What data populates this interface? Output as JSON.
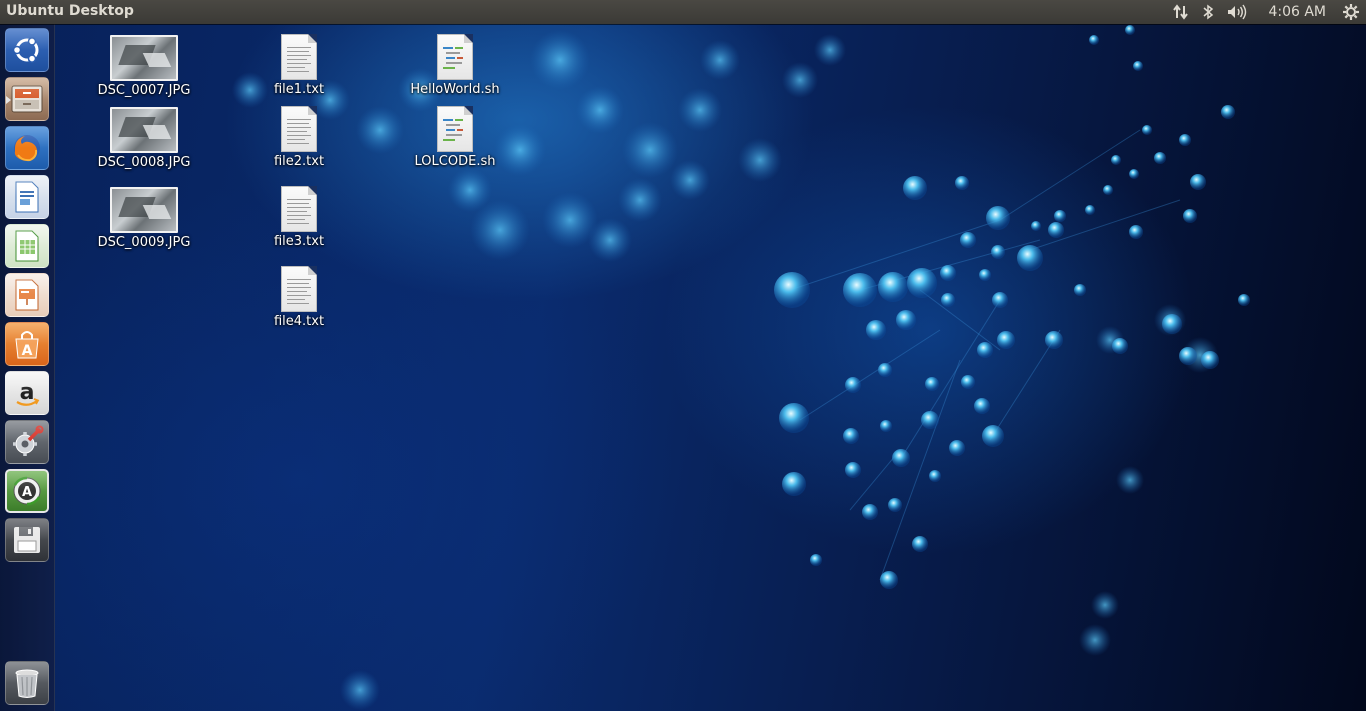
{
  "panel": {
    "title": "Ubuntu Desktop",
    "clock": "4:06 AM",
    "indicators": [
      "network-icon",
      "bluetooth-icon",
      "volume-icon",
      "session-gear-icon"
    ]
  },
  "launcher": {
    "items": [
      {
        "name": "dash-home-button",
        "icon": "ubuntu-logo-icon"
      },
      {
        "name": "files-button",
        "icon": "file-cabinet-icon"
      },
      {
        "name": "firefox-button",
        "icon": "firefox-icon"
      },
      {
        "name": "libreoffice-writer-button",
        "icon": "writer-document-icon"
      },
      {
        "name": "libreoffice-calc-button",
        "icon": "calc-spreadsheet-icon"
      },
      {
        "name": "libreoffice-impress-button",
        "icon": "impress-presentation-icon"
      },
      {
        "name": "ubuntu-software-center-button",
        "icon": "shopping-bag-icon"
      },
      {
        "name": "amazon-button",
        "icon": "amazon-icon"
      },
      {
        "name": "system-settings-button",
        "icon": "settings-wrench-icon"
      },
      {
        "name": "software-updater-button",
        "icon": "updater-icon"
      },
      {
        "name": "save-disk-button",
        "icon": "floppy-disk-icon"
      },
      {
        "name": "trash-button",
        "icon": "trash-icon"
      }
    ]
  },
  "desktop": {
    "icons": [
      {
        "label": "DSC_0007.JPG",
        "type": "image"
      },
      {
        "label": "DSC_0008.JPG",
        "type": "image"
      },
      {
        "label": "DSC_0009.JPG",
        "type": "image"
      },
      {
        "label": "file1.txt",
        "type": "text"
      },
      {
        "label": "file2.txt",
        "type": "text"
      },
      {
        "label": "file3.txt",
        "type": "text"
      },
      {
        "label": "file4.txt",
        "type": "text"
      },
      {
        "label": "HelloWorld.sh",
        "type": "script"
      },
      {
        "label": "LOLCODE.sh",
        "type": "script"
      }
    ]
  },
  "colors": {
    "panel_bg": "#3c3b37",
    "panel_text": "#dfdbd2",
    "wallpaper_blue": "#0a2b6e"
  }
}
